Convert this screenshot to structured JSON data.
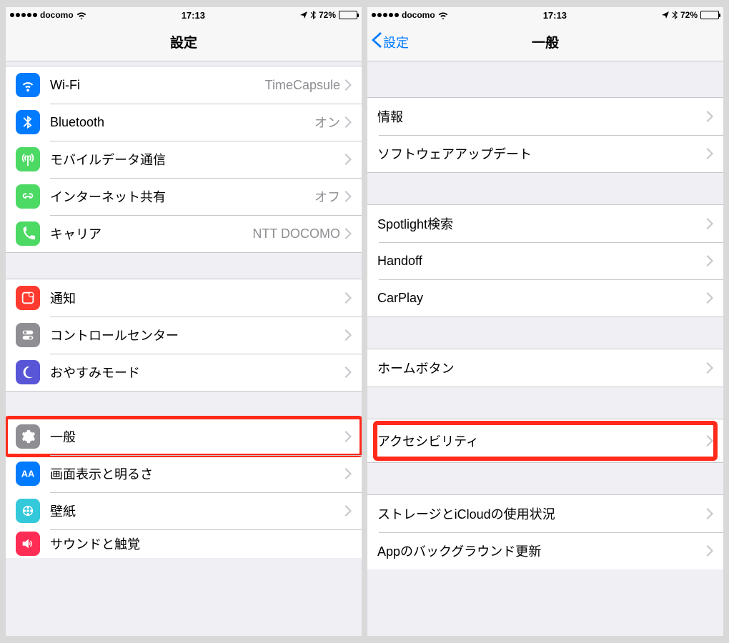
{
  "statusbar": {
    "carrier": "docomo",
    "time": "17:13",
    "battery_pct": "72%"
  },
  "left": {
    "title": "設定",
    "rows": {
      "wifi": {
        "label": "Wi-Fi",
        "value": "TimeCapsule"
      },
      "bluetooth": {
        "label": "Bluetooth",
        "value": "オン"
      },
      "cellular": {
        "label": "モバイルデータ通信",
        "value": ""
      },
      "hotspot": {
        "label": "インターネット共有",
        "value": "オフ"
      },
      "carrier": {
        "label": "キャリア",
        "value": "NTT DOCOMO"
      },
      "notif": {
        "label": "通知"
      },
      "control": {
        "label": "コントロールセンター"
      },
      "dnd": {
        "label": "おやすみモード"
      },
      "general": {
        "label": "一般"
      },
      "display": {
        "label": "画面表示と明るさ"
      },
      "wallpaper": {
        "label": "壁紙"
      },
      "sound": {
        "label": "サウンドと触覚"
      }
    }
  },
  "right": {
    "back": "設定",
    "title": "一般",
    "rows": {
      "about": {
        "label": "情報"
      },
      "update": {
        "label": "ソフトウェアアップデート"
      },
      "spotlight": {
        "label": "Spotlight検索"
      },
      "handoff": {
        "label": "Handoff"
      },
      "carplay": {
        "label": "CarPlay"
      },
      "home": {
        "label": "ホームボタン"
      },
      "access": {
        "label": "アクセシビリティ"
      },
      "storage": {
        "label": "ストレージとiCloudの使用状況"
      },
      "bgrefresh": {
        "label": "Appのバックグラウンド更新"
      }
    }
  }
}
